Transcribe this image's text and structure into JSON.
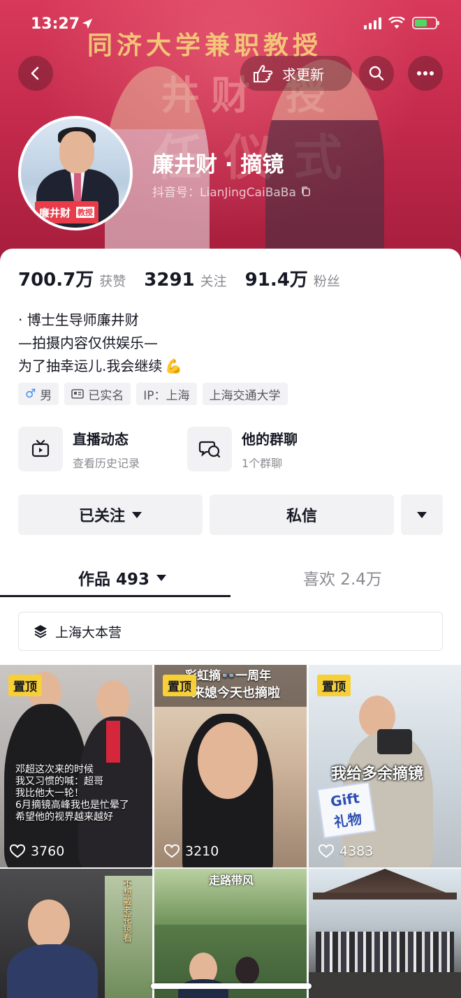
{
  "status_bar": {
    "time": "13:27"
  },
  "header": {
    "banner_title": "同济大学兼职教授",
    "banner_sub": "井财 授",
    "banner_sub2": "任仪式",
    "update_button": "求更新",
    "avatar_tag": "廉井财",
    "avatar_tag_small": "教授"
  },
  "profile": {
    "nickname": "廉井财 · 摘镜",
    "douyin_id": "抖音号：LianJingCaiBaBa"
  },
  "stats": [
    {
      "value": "700.7万",
      "label": "获赞"
    },
    {
      "value": "3291",
      "label": "关注"
    },
    {
      "value": "91.4万",
      "label": "粉丝"
    }
  ],
  "bio": [
    "· 博士生导师廉井财",
    "—拍摄内容仅供娱乐—",
    "为了抽幸运儿.我会继续"
  ],
  "tags": {
    "gender": "男",
    "verified": "已实名",
    "ip": "IP：上海",
    "school": "上海交通大学"
  },
  "shortcuts": {
    "live": {
      "title": "直播动态",
      "sub": "查看历史记录"
    },
    "group": {
      "title": "他的群聊",
      "sub": "1个群聊"
    }
  },
  "actions": {
    "follow": "已关注",
    "message": "私信"
  },
  "tabs": {
    "works": "作品 493",
    "likes": "喜欢 2.4万"
  },
  "collection": "上海大本营",
  "videos": [
    {
      "pinned": "置顶",
      "likes": "3760",
      "caption": [
        "邓超这次来的时候",
        "我又习惯的喊：超哥",
        "我比他大一轮！",
        "6月摘镜高峰我也是忙晕了",
        "希望他的视界越来越好"
      ]
    },
    {
      "pinned": "置顶",
      "likes": "3210",
      "caption": [
        "彩虹摘👓一周年",
        "来媳今天也摘啦"
      ]
    },
    {
      "pinned": "置顶",
      "likes": "4383",
      "caption": [
        "我给多余摘镜"
      ],
      "gift": [
        "Gift",
        "礼物"
      ]
    },
    {
      "caption": [
        "不想戴老花镜看"
      ]
    },
    {
      "caption": [
        "走路带风"
      ]
    },
    {
      "caption": []
    }
  ],
  "colors": {
    "accent_cover": "#c42a4c",
    "pin_yellow": "#f7cf36",
    "gender_blue": "#3b8ef0"
  }
}
